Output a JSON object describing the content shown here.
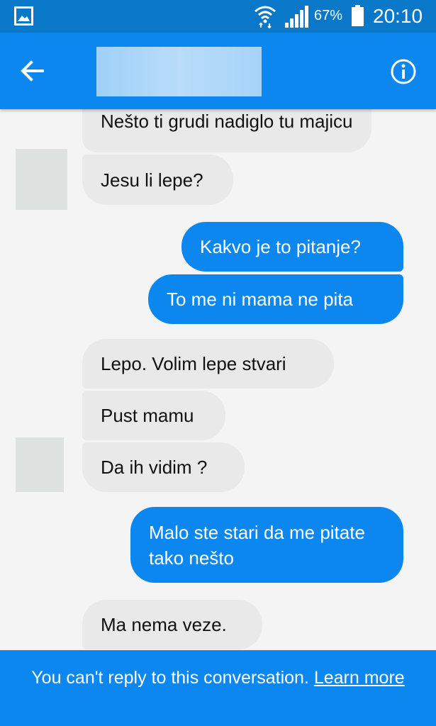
{
  "status_bar": {
    "battery_percent": "67%",
    "time": "20:10",
    "icons": [
      "gallery-icon",
      "wifi-icon",
      "signal-icon",
      "battery-icon"
    ]
  },
  "header": {
    "contact_name": "",
    "back_icon": "arrow-left-icon",
    "info_icon": "info-icon"
  },
  "messages": [
    {
      "from": "them",
      "text": "Nešto ti grudi nadiglo tu majicu"
    },
    {
      "from": "them",
      "text": "Jesu li lepe?"
    },
    {
      "from": "me",
      "text": "Kakvo je to pitanje?"
    },
    {
      "from": "me",
      "text": "To me ni mama ne pita"
    },
    {
      "from": "them",
      "text": "Lepo. Volim lepe stvari"
    },
    {
      "from": "them",
      "text": "Pust mamu"
    },
    {
      "from": "them",
      "text": "Da ih vidim ?"
    },
    {
      "from": "me",
      "text": "Malo ste stari da me pitate tako nešto"
    },
    {
      "from": "them",
      "text": "Ma nema veze."
    }
  ],
  "footer": {
    "notice": "You can't reply to this conversation.",
    "link": "Learn more"
  },
  "colors": {
    "status_bar": "#0a78c9",
    "accent": "#0d87f0",
    "incoming_bubble": "#e9e9ea",
    "background": "#f4f4f4"
  }
}
